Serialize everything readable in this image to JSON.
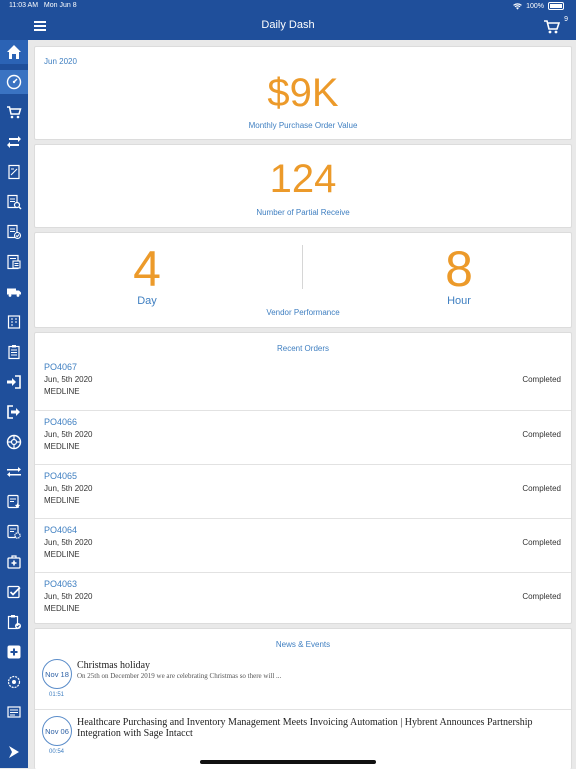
{
  "status_bar": {
    "time": "11:03 AM",
    "date": "Mon Jun 8",
    "battery": "100%"
  },
  "nav": {
    "title": "Daily Dash",
    "cart_count": "9"
  },
  "sidebar": {
    "icons": [
      "home-icon",
      "dashboard-gauge-icon",
      "cart-icon",
      "sync-icon",
      "invoice-icon",
      "search-document-icon",
      "document-check-icon",
      "document-list-icon",
      "truck-icon",
      "calendar-icon",
      "clipboard-icon",
      "sign-in-icon",
      "sign-out-icon",
      "globe-icon",
      "transfer-icon",
      "checklist-star-icon",
      "checklist-gear-icon",
      "medical-kit-icon",
      "checkbox-icon",
      "clipboard-check-icon",
      "plus-square-icon",
      "settings-network-icon",
      "list-icon",
      "logo-icon"
    ]
  },
  "kpi": {
    "period": "Jun 2020",
    "po_value": "$9K",
    "po_label": "Monthly Purchase Order Value",
    "partial_count": "124",
    "partial_label": "Number of Partial Receive"
  },
  "vendor_perf": {
    "day_value": "4",
    "day_label": "Day",
    "hour_value": "8",
    "hour_label": "Hour",
    "label": "Vendor Performance"
  },
  "recent_orders": {
    "title": "Recent Orders",
    "items": [
      {
        "id": "PO4067",
        "date": "Jun, 5th 2020",
        "vendor": "MEDLINE",
        "status": "Completed"
      },
      {
        "id": "PO4066",
        "date": "Jun, 5th 2020",
        "vendor": "MEDLINE",
        "status": "Completed"
      },
      {
        "id": "PO4065",
        "date": "Jun, 5th 2020",
        "vendor": "MEDLINE",
        "status": "Completed"
      },
      {
        "id": "PO4064",
        "date": "Jun, 5th 2020",
        "vendor": "MEDLINE",
        "status": "Completed"
      },
      {
        "id": "PO4063",
        "date": "Jun, 5th 2020",
        "vendor": "MEDLINE",
        "status": "Completed"
      }
    ]
  },
  "news": {
    "title": "News & Events",
    "items": [
      {
        "date": "Nov 18",
        "time": "01:51",
        "title": "Christmas holiday",
        "excerpt": "On 25th on December 2019 we are celebrating Christmas so there will ..."
      },
      {
        "date": "Nov 06",
        "time": "00:54",
        "title": "Healthcare Purchasing and Inventory Management Meets Invoicing Automation | Hybrent Announces Partnership Integration with Sage Intacct",
        "excerpt": ""
      }
    ]
  },
  "colors": {
    "brand": "#1f4f9b",
    "accent": "#ec9a2a",
    "link": "#3f7fc1"
  }
}
